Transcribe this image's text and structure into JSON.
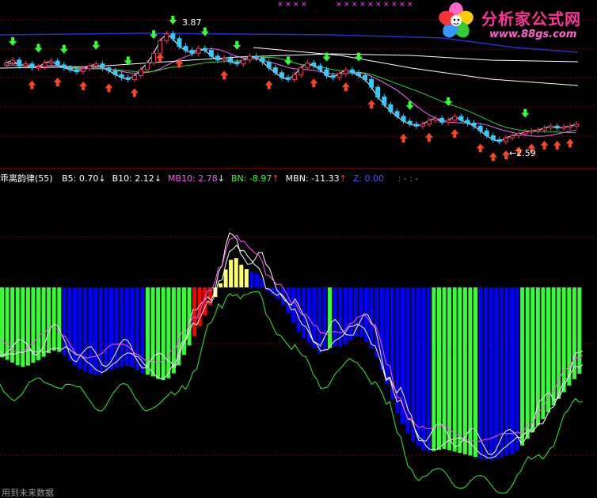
{
  "logo": {
    "name": "分析家公式网",
    "url": "www.88gs.com"
  },
  "price_panel": {
    "high_label": "3.87",
    "low_label": "←2.59"
  },
  "indicator_header": {
    "name": "乖离韵律(55)",
    "items": [
      {
        "label": "B5: 0.70",
        "arrow": "↓",
        "color": "#ffffff",
        "arrow_color": "#ffffff"
      },
      {
        "label": "B10: 2.12",
        "arrow": "↓",
        "color": "#ffffff",
        "arrow_color": "#ffffff"
      },
      {
        "label": "MB10: 2.78",
        "arrow": "↓",
        "color": "#ff55ff",
        "arrow_color": "#ffffff"
      },
      {
        "label": "BN: -8.97",
        "arrow": "↑",
        "color": "#33ff33",
        "arrow_color": "#ff4444"
      },
      {
        "label": "MBN: -11.33",
        "arrow": "↑",
        "color": "#ffffff",
        "arrow_color": "#ff4444"
      },
      {
        "label": "Z: 0.00",
        "arrow": "",
        "color": "#4455ff",
        "arrow_color": "#ffffff"
      }
    ],
    "trailing": ": - : -"
  },
  "footer": {
    "note": "用到未来数据"
  },
  "colors": {
    "bg": "#000000",
    "up": "#ff3366",
    "down": "#33ccff",
    "green_bar": "#33ff33",
    "blue_bar": "#0000ff",
    "red_bar": "#ff0000",
    "yellow_bar": "#ffff66",
    "magenta": "#ff44ff",
    "dashed": "#880000"
  },
  "chart_data": [
    {
      "type": "candlestick",
      "title": "",
      "high": 3.87,
      "low": 2.59,
      "closes": [
        3.45,
        3.48,
        3.42,
        3.44,
        3.4,
        3.41,
        3.45,
        3.47,
        3.43,
        3.4,
        3.38,
        3.36,
        3.39,
        3.42,
        3.44,
        3.4,
        3.37,
        3.33,
        3.3,
        3.28,
        3.32,
        3.38,
        3.45,
        3.55,
        3.68,
        3.75,
        3.7,
        3.62,
        3.58,
        3.55,
        3.6,
        3.58,
        3.52,
        3.48,
        3.5,
        3.46,
        3.44,
        3.48,
        3.52,
        3.5,
        3.46,
        3.4,
        3.35,
        3.3,
        3.28,
        3.33,
        3.4,
        3.45,
        3.42,
        3.38,
        3.32,
        3.3,
        3.34,
        3.38,
        3.35,
        3.32,
        3.28,
        3.2,
        3.1,
        3.02,
        2.95,
        2.9,
        2.85,
        2.82,
        2.8,
        2.82,
        2.86,
        2.88,
        2.84,
        2.86,
        2.9,
        2.86,
        2.83,
        2.8,
        2.75,
        2.7,
        2.66,
        2.64,
        2.68,
        2.7,
        2.72,
        2.74,
        2.75,
        2.76,
        2.78,
        2.8,
        2.78,
        2.79,
        2.8,
        2.82
      ],
      "up_signals": [
        4,
        8,
        12,
        16,
        20,
        24,
        27,
        34,
        41,
        48,
        53,
        57,
        62,
        66,
        70,
        74,
        76,
        78,
        80,
        82,
        84,
        86,
        88
      ],
      "down_signals": [
        1,
        5,
        9,
        14,
        19,
        23,
        26,
        31,
        36,
        44,
        50,
        55,
        63,
        69,
        81
      ]
    },
    {
      "type": "bar",
      "title": "乖离韵律(55)",
      "ylim": [
        -14,
        6
      ],
      "values": [
        -4.2,
        -4.4,
        -4.6,
        -4.8,
        -4.7,
        -4.5,
        -4.3,
        -4.0,
        -3.8,
        -3.9,
        -4.2,
        -4.6,
        -4.9,
        -5.1,
        -5.2,
        -5.3,
        -5.1,
        -4.9,
        -4.8,
        -4.7,
        -4.8,
        -5.0,
        -5.2,
        -5.3,
        -5.5,
        -5.6,
        -5.4,
        -4.9,
        -4.1,
        -3.4,
        -2.7,
        -1.9,
        -1.1,
        -0.5,
        0.6,
        1.6,
        1.8,
        1.3,
        1.0,
        0.9,
        0.6,
        -0.3,
        -0.5,
        -0.9,
        -1.5,
        -2.2,
        -2.9,
        -3.2,
        -3.6,
        -4.0,
        -3.8,
        -3.5,
        -3.6,
        -3.4,
        -3.1,
        -2.9,
        -3.2,
        -3.7,
        -4.4,
        -5.4,
        -6.6,
        -7.6,
        -8.4,
        -9.1,
        -9.5,
        -9.8,
        -9.9,
        -9.8,
        -9.7,
        -9.8,
        -9.9,
        -10.0,
        -10.1,
        -10.2,
        -10.3,
        -10.4,
        -10.3,
        -10.2,
        -10.1,
        -10.0,
        -9.6,
        -9.1,
        -8.6,
        -8.1,
        -7.6,
        -7.1,
        -6.6,
        -6.1,
        -5.6,
        -5.2
      ],
      "bar_color_codes": "GGGGGGGGGGGGBBBBBBBBBBBBBBBBGGGGGGGGGRRRRYYYYYYYBBBBBBBBBBBBBBBGBBBBBBBBBBBBBBBBBBBGGGGGGGGGBBBBBBBBGGGGGGGGGGGG"
    }
  ]
}
